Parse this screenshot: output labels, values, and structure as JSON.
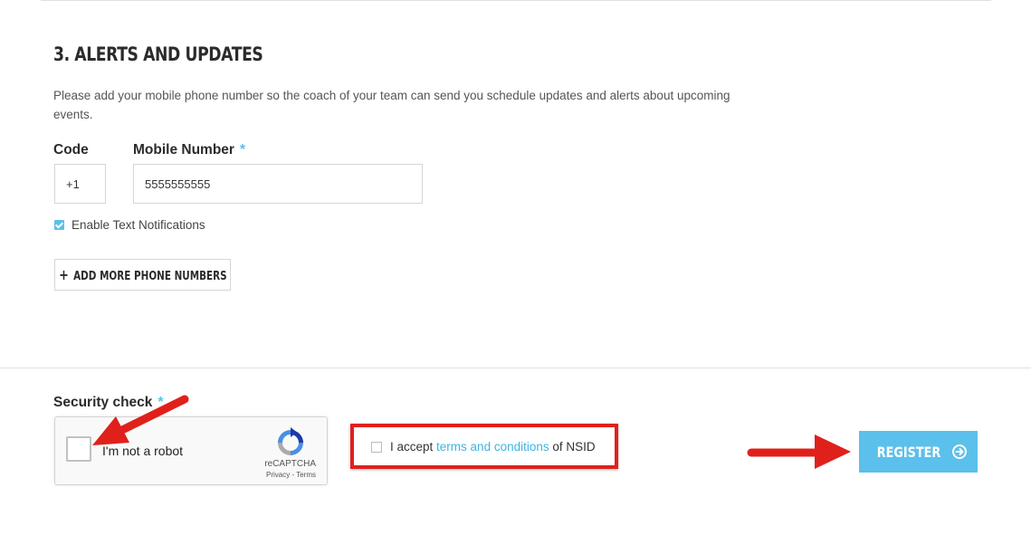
{
  "section": {
    "title": "3. ALERTS AND UPDATES",
    "description": "Please add your mobile phone number so the coach of your team can send you schedule updates and alerts about upcoming events."
  },
  "phone": {
    "code_label": "Code",
    "code_value": "+1",
    "mobile_label": "Mobile Number",
    "required_mark": "*",
    "mobile_value": "5555555555"
  },
  "notifications": {
    "label": "Enable Text Notifications",
    "checked": true
  },
  "add_phone_button": {
    "plus": "+",
    "label": "ADD MORE PHONE NUMBERS"
  },
  "security": {
    "label": "Security check",
    "required_mark": "*",
    "recaptcha_label": "I'm not a robot",
    "recaptcha_brand": "reCAPTCHA",
    "recaptcha_links": "Privacy - Terms"
  },
  "terms": {
    "prefix": "I accept",
    "link_text": "terms and conditions",
    "suffix": "of NSID",
    "checked": false
  },
  "register_button": {
    "label": "REGISTER"
  },
  "colors": {
    "accent": "#5bc0eb",
    "link": "#3fb4e0",
    "annotation_red": "#e0201b"
  }
}
